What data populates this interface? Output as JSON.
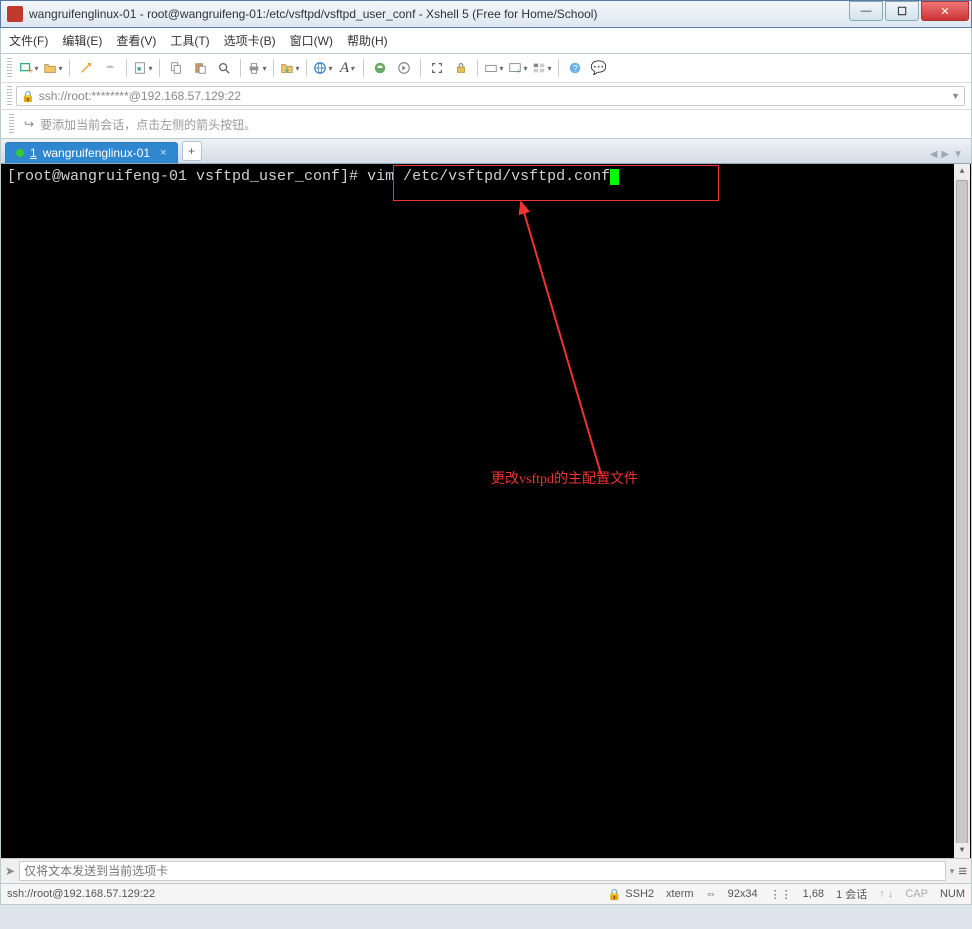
{
  "window": {
    "title": "wangruifenglinux-01 - root@wangruifeng-01:/etc/vsftpd/vsftpd_user_conf - Xshell 5 (Free for Home/School)"
  },
  "menu": {
    "file": "文件(F)",
    "edit": "编辑(E)",
    "view": "查看(V)",
    "tools": "工具(T)",
    "tab": "选项卡(B)",
    "window": "窗口(W)",
    "help": "帮助(H)"
  },
  "address": {
    "text": "ssh://root:********@192.168.57.129:22"
  },
  "tip": {
    "text": "要添加当前会话，点击左侧的箭头按钮。"
  },
  "tab": {
    "index": "1",
    "name": "wangruifenglinux-01"
  },
  "terminal": {
    "prompt": "[root@wangruifeng-01 vsftpd_user_conf]# ",
    "command": "vim /etc/vsftpd/vsftpd.conf"
  },
  "annotation": {
    "text": "更改vsftpd的主配置文件"
  },
  "input": {
    "placeholder": "仅将文本发送到当前选项卡"
  },
  "status": {
    "conn": "ssh://root@192.168.57.129:22",
    "proto": "SSH2",
    "term": "xterm",
    "size": "92x34",
    "pos": "1,68",
    "sessions": "1 会话",
    "cap": "CAP",
    "num": "NUM"
  }
}
